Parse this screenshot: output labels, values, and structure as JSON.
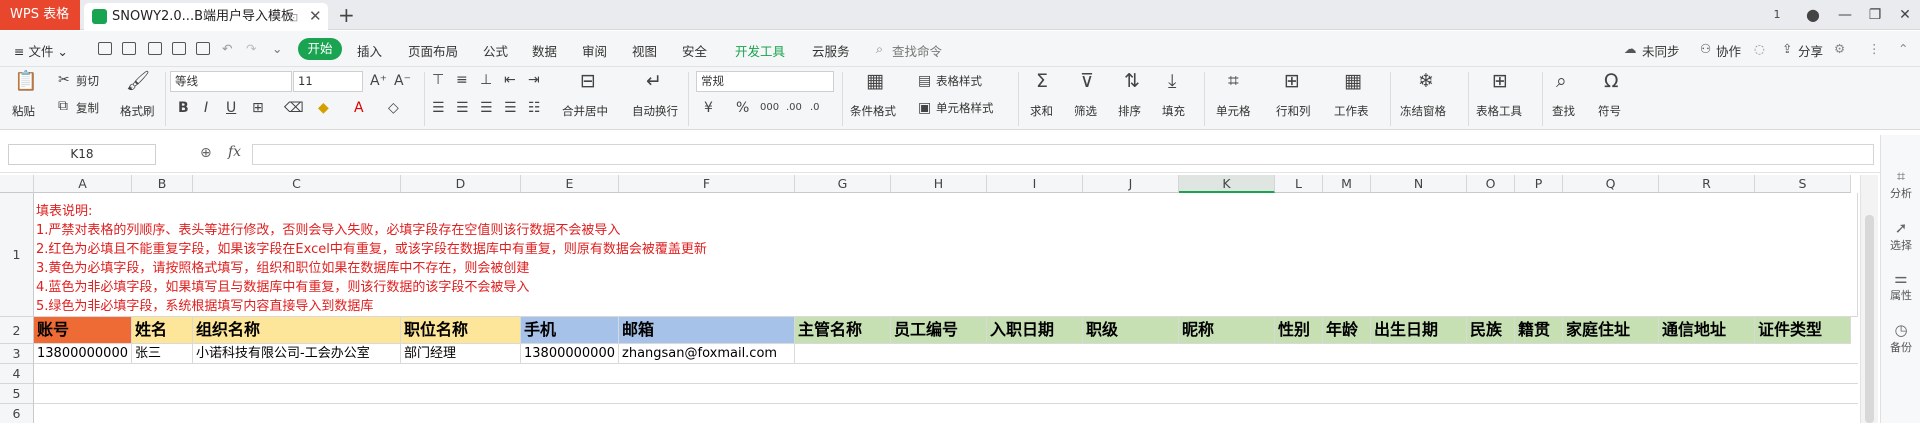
{
  "titlebar": {
    "app_tab": "WPS 表格",
    "doc_tab": "SNOWY2.0...B端用户导入模板",
    "pin": "⊡",
    "close": "✕",
    "new_tab": "+",
    "win_controls": [
      "1",
      "—",
      "❐",
      "✕"
    ]
  },
  "menu": {
    "file": "≡ 文件 ⌄",
    "start": "开始",
    "tabs": [
      "插入",
      "页面布局",
      "公式",
      "数据",
      "审阅",
      "视图",
      "安全",
      "开发工具",
      "云服务"
    ],
    "search": "查找命令",
    "right": [
      "未同步",
      "协作",
      "分享"
    ]
  },
  "ribbon": {
    "paste": "粘贴",
    "cut": "剪切",
    "copy": "复制",
    "format_painter": "格式刷",
    "font_name": "等线",
    "font_size": "11",
    "merge_center": "合并居中",
    "wrap_text": "自动换行",
    "number_format": "常规",
    "cond_format": "条件格式",
    "table_style": "表格样式",
    "cell_style": "单元格样式",
    "sum": "求和",
    "filter": "筛选",
    "sort": "排序",
    "fill": "填充",
    "cell": "单元格",
    "row_col": "行和列",
    "sheet": "工作表",
    "freeze": "冻结窗格",
    "table_tools": "表格工具",
    "find": "查找",
    "symbol": "符号"
  },
  "formula_bar": {
    "name_box": "K18",
    "fx": "fx",
    "value": ""
  },
  "right_panel": [
    "分析",
    "选择",
    "属性",
    "备份"
  ],
  "grid": {
    "columns": [
      "A",
      "B",
      "C",
      "D",
      "E",
      "F",
      "G",
      "H",
      "I",
      "J",
      "K",
      "L",
      "M",
      "N",
      "O",
      "P",
      "Q",
      "R",
      "S"
    ],
    "rows": [
      "1",
      "2",
      "3",
      "4",
      "5",
      "6"
    ],
    "notes": [
      "填表说明:",
      "1.严禁对表格的列顺序、表头等进行修改，否则会导入失败，必填字段存在空值则该行数据不会被导入",
      "2.红色为必填且不能重复字段，如果该字段在Excel中有重复，或该字段在数据库中有重复，则原有数据会被覆盖更新",
      "3.黄色为必填字段，请按照格式填写，组织和职位如果在数据库中不存在，则会被创建",
      "4.蓝色为非必填字段，如果填写且与数据库中有重复，则该行数据的该字段不会被导入",
      "5.绿色为非必填字段，系统根据填写内容直接导入到数据库"
    ],
    "headers": [
      "账号",
      "姓名",
      "组织名称",
      "职位名称",
      "手机",
      "邮箱",
      "主管名称",
      "员工编号",
      "入职日期",
      "职级",
      "昵称",
      "性别",
      "年龄",
      "出生日期",
      "民族",
      "籍贯",
      "家庭住址",
      "通信地址",
      "证件类型"
    ],
    "row3": [
      "13800000000",
      "张三",
      "小诺科技有限公司-工会办公室",
      "部门经理",
      "13800000000",
      "zhangsan@foxmail.com"
    ]
  },
  "colors": {
    "required_unique": "#ef6b36",
    "required": "#fde599",
    "optional_blue": "#a7c2e8",
    "optional_green": "#c6e0b4",
    "note_text": "#e02020",
    "brand": "#1aa350"
  }
}
